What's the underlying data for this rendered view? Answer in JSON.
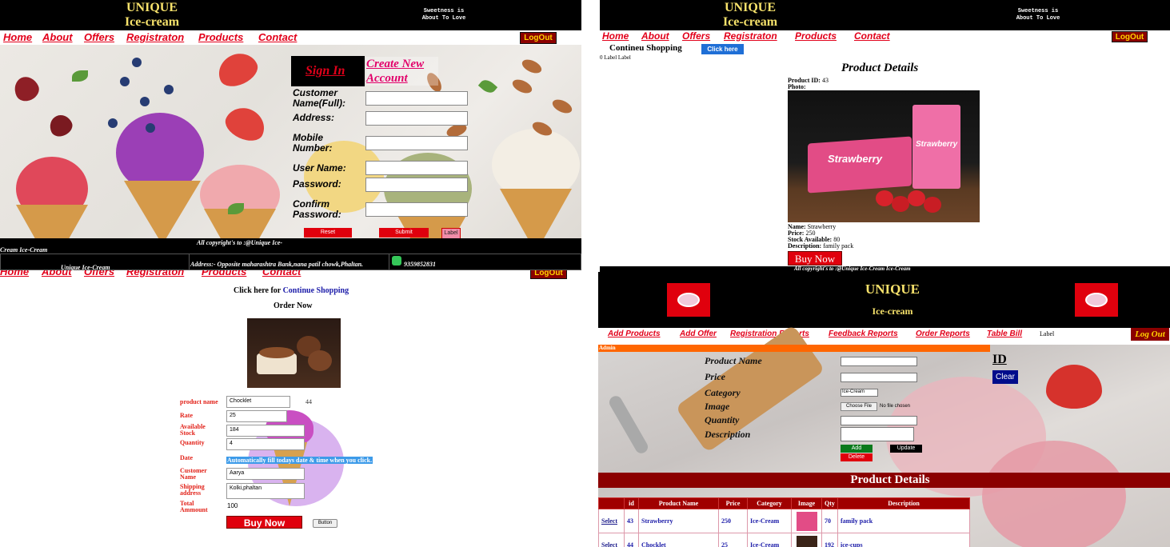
{
  "brand": {
    "line1": "UNIQUE",
    "line2": "Ice-cream",
    "tagline1": "Sweetness is",
    "tagline2": "About To Love"
  },
  "nav": [
    "Home",
    "About",
    "Offers",
    "Registraton",
    "Products",
    "Contact"
  ],
  "logout_label": "LogOut",
  "signin": {
    "sign_in": "Sign In",
    "create_account": "Create New Account",
    "fields": [
      "Customer Name(Full):",
      "Address:",
      "Mobile Number:",
      "User Name:",
      "Password:",
      "Confirm Password:"
    ],
    "reset": "Reset",
    "submit": "Submit",
    "label": "Label",
    "copyright": "All copyright's to :@Unique Ice-",
    "copyright2": "Cream Ice-Cream",
    "footer_name": "Unique Ice-Cream",
    "footer_address": "Address:- Opposite maharashtra Bank,nana patil chowk,Phaltan.",
    "footer_phone": "9359852831"
  },
  "product_details": {
    "continue_text": "Contineu Shopping",
    "click_here": "Click here",
    "label_text": "0 Label Label",
    "title": "Product Details",
    "id_label": "Product ID:",
    "id_value": "43",
    "photo_label": "Photo:",
    "name_label": "Name:",
    "name_value": "Strawberry",
    "price_label": "Price:",
    "price_value": "250",
    "stock_label": "Stock Available:",
    "stock_value": "80",
    "desc_label": "Description:",
    "desc_value": "family pack",
    "buy_now": "Buy Now",
    "copyright": "All copyright's to :@Unique Ice-Cream Ice-Cream",
    "box_text": "Strawberry"
  },
  "order": {
    "click_here_for": "Click here for",
    "continue_link": "Continue Shopping",
    "order_now": "Order Now",
    "fields": [
      {
        "label": "product name",
        "value": "Chocklet"
      },
      {
        "label": "Rate",
        "value": "25"
      },
      {
        "label": "Available Stock",
        "value": "184"
      },
      {
        "label": "Quantity",
        "value": "4"
      },
      {
        "label": "Date",
        "value": ""
      },
      {
        "label": "Customer Name",
        "value": "Aarya"
      },
      {
        "label": "Shipping address",
        "value": "Kolki,phaltan"
      },
      {
        "label": "Total Ammount",
        "value": "100"
      }
    ],
    "product_id": "44",
    "date_hint": "Automatically fill todays date & time when you click.",
    "buy_now": "Buy Now",
    "button": "Button"
  },
  "admin": {
    "title": "UNIQUE",
    "subtitle": "Ice-cream",
    "nav": [
      "Add Products",
      "Add Offer",
      "Registration Reports",
      "Feedback Reports",
      "Order Reports",
      "Table Bill"
    ],
    "label": "Label",
    "logout": "Log Out",
    "admin_label": "Admin",
    "fields": [
      "Product Name",
      "Price",
      "Category",
      "Image",
      "Quantity",
      "Description"
    ],
    "category_value": "Ice-Cream",
    "choose_file": "Choose File",
    "no_file": "No file chosen",
    "id_label": "ID",
    "clear": "Clear",
    "add": "Add",
    "update": "Update",
    "delete": "Delete",
    "section_title": "Product Details",
    "table": {
      "headers": [
        "",
        "id",
        "Product Name",
        "Price",
        "Category",
        "Image",
        "Qty",
        "Description"
      ],
      "rows": [
        {
          "select": "Select",
          "id": "43",
          "name": "Strawberry",
          "price": "250",
          "category": "Ice-Cream",
          "qty": "70",
          "desc": "family pack"
        },
        {
          "select": "Select",
          "id": "44",
          "name": "Chocklet",
          "price": "25",
          "category": "Ice-Cream",
          "qty": "192",
          "desc": "ice-cups"
        }
      ]
    }
  },
  "colors": {
    "nav_red": "#e2001a",
    "header_bg": "#000000",
    "brand_yellow": "#f7e26b",
    "logout_bg": "#8b0000",
    "admin_red": "#a00000",
    "orange": "#ff6600"
  }
}
